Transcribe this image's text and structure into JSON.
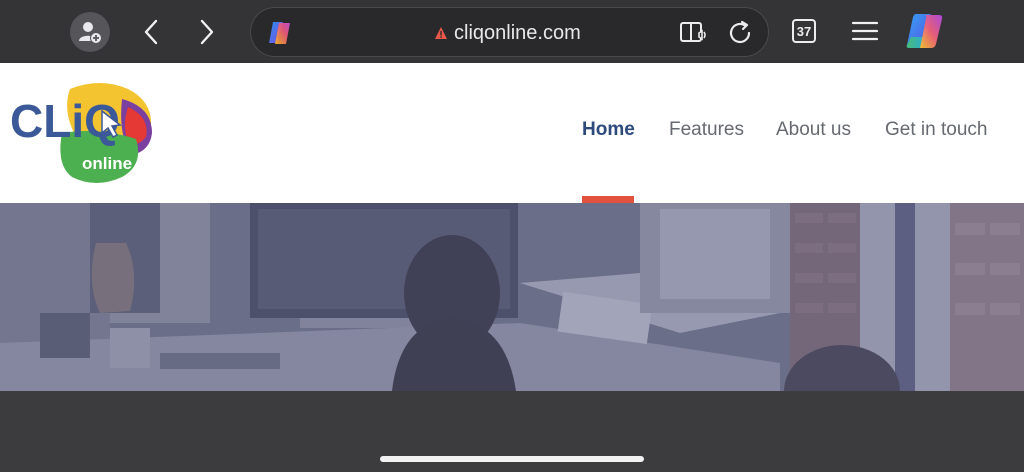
{
  "browser": {
    "url": "cliqonline.com",
    "tab_count": "37",
    "icons": {
      "profile": "add-profile-icon",
      "back": "chevron-left-icon",
      "forward": "chevron-right-icon",
      "copilot": "copilot-icon",
      "warning": "warning-icon",
      "reader": "reader-aloud-icon",
      "reload": "reload-icon",
      "tabs": "tabs-icon",
      "menu": "menu-icon"
    }
  },
  "site": {
    "logo": {
      "wordmark": "CLiQ",
      "sub": "online"
    },
    "nav": [
      {
        "label": "Home",
        "active": true
      },
      {
        "label": "Features",
        "active": false
      },
      {
        "label": "About us",
        "active": false
      },
      {
        "label": "Get in touch",
        "active": false
      }
    ],
    "colors": {
      "nav_active": "#2e4a7d",
      "nav_text": "#666a70",
      "active_indicator": "#e0523e",
      "logo_blue": "#3b5998",
      "logo_green": "#4caf50",
      "logo_yellow": "#f4c430",
      "logo_purple": "#7b3fa0",
      "logo_red": "#e53935"
    }
  }
}
